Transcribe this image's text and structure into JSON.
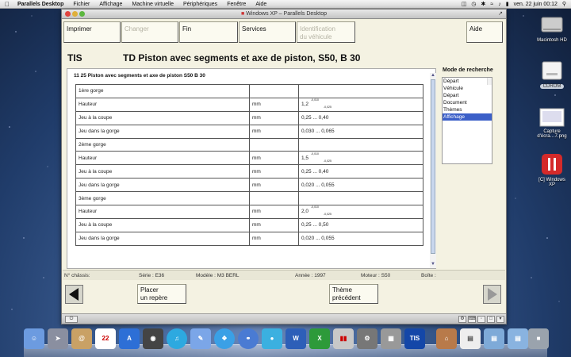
{
  "menubar": {
    "app_name": "Parallels Desktop",
    "items": [
      "Fichier",
      "Affichage",
      "Machine virtuelle",
      "Périphériques",
      "Fenêtre",
      "Aide"
    ],
    "clock": "ven. 22 juin  00:12"
  },
  "window": {
    "title": "Windows XP – Parallels Desktop"
  },
  "toolbar": {
    "imprimer": "Imprimer",
    "changer": "Changer",
    "fin": "Fin",
    "services": "Services",
    "identification_l1": "Identification",
    "identification_l2": "du véhicule",
    "aide": "Aide"
  },
  "header": {
    "tis": "TIS",
    "title": "TD  Piston avec segments et axe de piston, S50, B 30"
  },
  "content": {
    "panel_title": "11 25 Piston avec segments et axe de piston S50  B 30",
    "rows": [
      {
        "label": "1ère gorge",
        "unit": "",
        "value": "",
        "tol_up": "",
        "tol_down": ""
      },
      {
        "label": "Hauteur",
        "unit": "mm",
        "value": "1,2",
        "tol_up": "-0,010",
        "tol_down": "-0,025"
      },
      {
        "label": "Jeu à la coupe",
        "unit": "mm",
        "value": "0,25 ... 0,40",
        "tol_up": "",
        "tol_down": ""
      },
      {
        "label": "Jeu dans la gorge",
        "unit": "mm",
        "value": "0,030 ... 0,065",
        "tol_up": "",
        "tol_down": ""
      },
      {
        "label": "2ème gorge",
        "unit": "",
        "value": "",
        "tol_up": "",
        "tol_down": ""
      },
      {
        "label": "Hauteur",
        "unit": "mm",
        "value": "1,5",
        "tol_up": "-0,010",
        "tol_down": "-0,025"
      },
      {
        "label": "Jeu à la coupe",
        "unit": "mm",
        "value": "0,25 ... 0,40",
        "tol_up": "",
        "tol_down": ""
      },
      {
        "label": "Jeu dans la gorge",
        "unit": "mm",
        "value": "0,020 ... 0,055",
        "tol_up": "",
        "tol_down": ""
      },
      {
        "label": "3ème gorge",
        "unit": "",
        "value": "",
        "tol_up": "",
        "tol_down": ""
      },
      {
        "label": "Hauteur",
        "unit": "mm",
        "value": "2,0",
        "tol_up": "-0,010",
        "tol_down": "-0,025"
      },
      {
        "label": "Jeu à la coupe",
        "unit": "mm",
        "value": "0,25 ... 0,50",
        "tol_up": "",
        "tol_down": ""
      },
      {
        "label": "Jeu dans la gorge",
        "unit": "mm",
        "value": "0,020 ... 0,055",
        "tol_up": "",
        "tol_down": ""
      }
    ]
  },
  "search_mode": {
    "label": "Mode de recherche",
    "items": [
      "Départ",
      "Véhicule",
      "Départ",
      "Document",
      "Thèmes",
      "Affichage"
    ],
    "selected_index": 5
  },
  "status": {
    "chassis": "N° châssis:",
    "serie": "Série : E36",
    "modele": "Modèle : M3 BERL",
    "annee": "Année : 1997",
    "moteur": "Moteur : S50",
    "boite": "Boîte :"
  },
  "nav": {
    "placer_l1": "Placer",
    "placer_l2": "un repère",
    "theme_l1": "Thème",
    "theme_l2": "précédent"
  },
  "desktop_icons": {
    "hd": "Macintosh HD",
    "cdrom": "CDROM",
    "capture_l1": "Capture",
    "capture_l2": "d'écra…7.png",
    "winxp_l1": "[C] Windows",
    "winxp_l2": "XP"
  },
  "dock": {
    "calendar_day": "22",
    "tis_label": "TIS"
  },
  "colors": {
    "selection": "#3b5fc8",
    "window_bg": "#f4f2e2",
    "desktop": "#24426a"
  }
}
